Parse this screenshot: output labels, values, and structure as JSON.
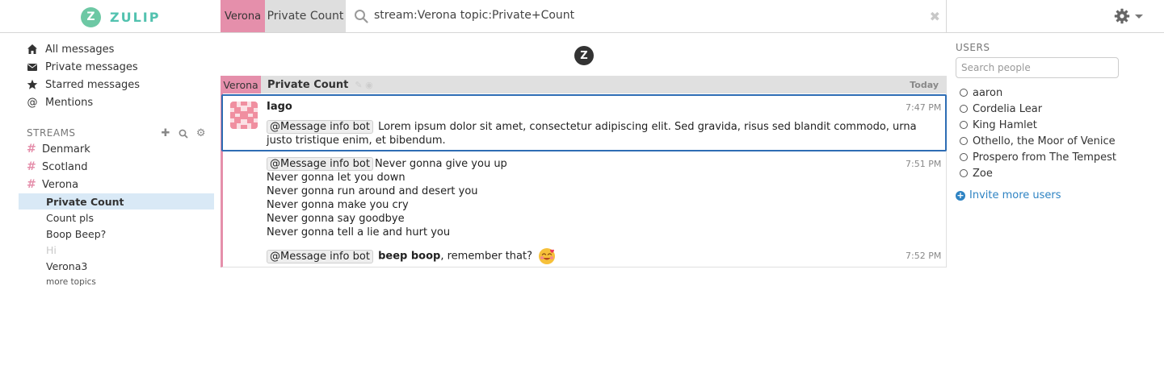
{
  "brand": {
    "logo_letter": "Z",
    "name": "ZULIP"
  },
  "navbar": {
    "stream": "Verona",
    "topic": "Private Count",
    "search_query": "stream:Verona topic:Private+Count",
    "clear_glyph": "✖"
  },
  "left_sidebar": {
    "filters": [
      {
        "label": "All messages",
        "icon": "home-icon"
      },
      {
        "label": "Private messages",
        "icon": "envelope-icon"
      },
      {
        "label": "Starred messages",
        "icon": "star-icon"
      },
      {
        "label": "Mentions",
        "icon": "at-icon"
      }
    ],
    "streams_header": "STREAMS",
    "streams": [
      {
        "name": "Denmark",
        "color": "#e58fab"
      },
      {
        "name": "Scotland",
        "color": "#e58fab"
      },
      {
        "name": "Verona",
        "color": "#e58fab"
      }
    ],
    "topics": [
      {
        "name": "Private Count",
        "state": "active"
      },
      {
        "name": "Count pls",
        "state": "normal"
      },
      {
        "name": "Boop Beep?",
        "state": "normal"
      },
      {
        "name": "Hi",
        "state": "muted"
      },
      {
        "name": "Verona3",
        "state": "normal"
      }
    ],
    "more_topics": "more topics"
  },
  "center_logo_letter": "Z",
  "recipient_bar": {
    "stream": "Verona",
    "topic": "Private Count",
    "date": "Today"
  },
  "messages": [
    {
      "sender": "Iago",
      "time": "7:47 PM",
      "mention": "@Message info bot",
      "line1": "Lorem ipsum dolor sit amet, consectetur adipiscing elit. Sed gravida, risus sed blandit commodo, urna",
      "line2": "justo tristique enim, et bibendum."
    },
    {
      "time": "7:51 PM",
      "mention": "@Message info bot",
      "lines": [
        "Never gonna give you up",
        "Never gonna let you down",
        "Never gonna run around and desert you",
        "Never gonna make you cry",
        "Never gonna say goodbye",
        "Never gonna tell a lie and hurt you"
      ]
    },
    {
      "time": "7:52 PM",
      "mention": "@Message info bot",
      "bold": "beep boop",
      "rest": ", remember that?",
      "emoji": "smiling-face-with-hearts-icon"
    }
  ],
  "right_sidebar": {
    "users_header": "USERS",
    "search_placeholder": "Search people",
    "users": [
      "aaron",
      "Cordelia Lear",
      "King Hamlet",
      "Othello, the Moor of Venice",
      "Prospero from The Tempest",
      "Zoe"
    ],
    "invite_label": "Invite more users"
  },
  "colors": {
    "accent": "#52c2af",
    "stream_verona": "#e58fab",
    "selected_border": "#2e6db4",
    "link": "#2e83c3"
  }
}
